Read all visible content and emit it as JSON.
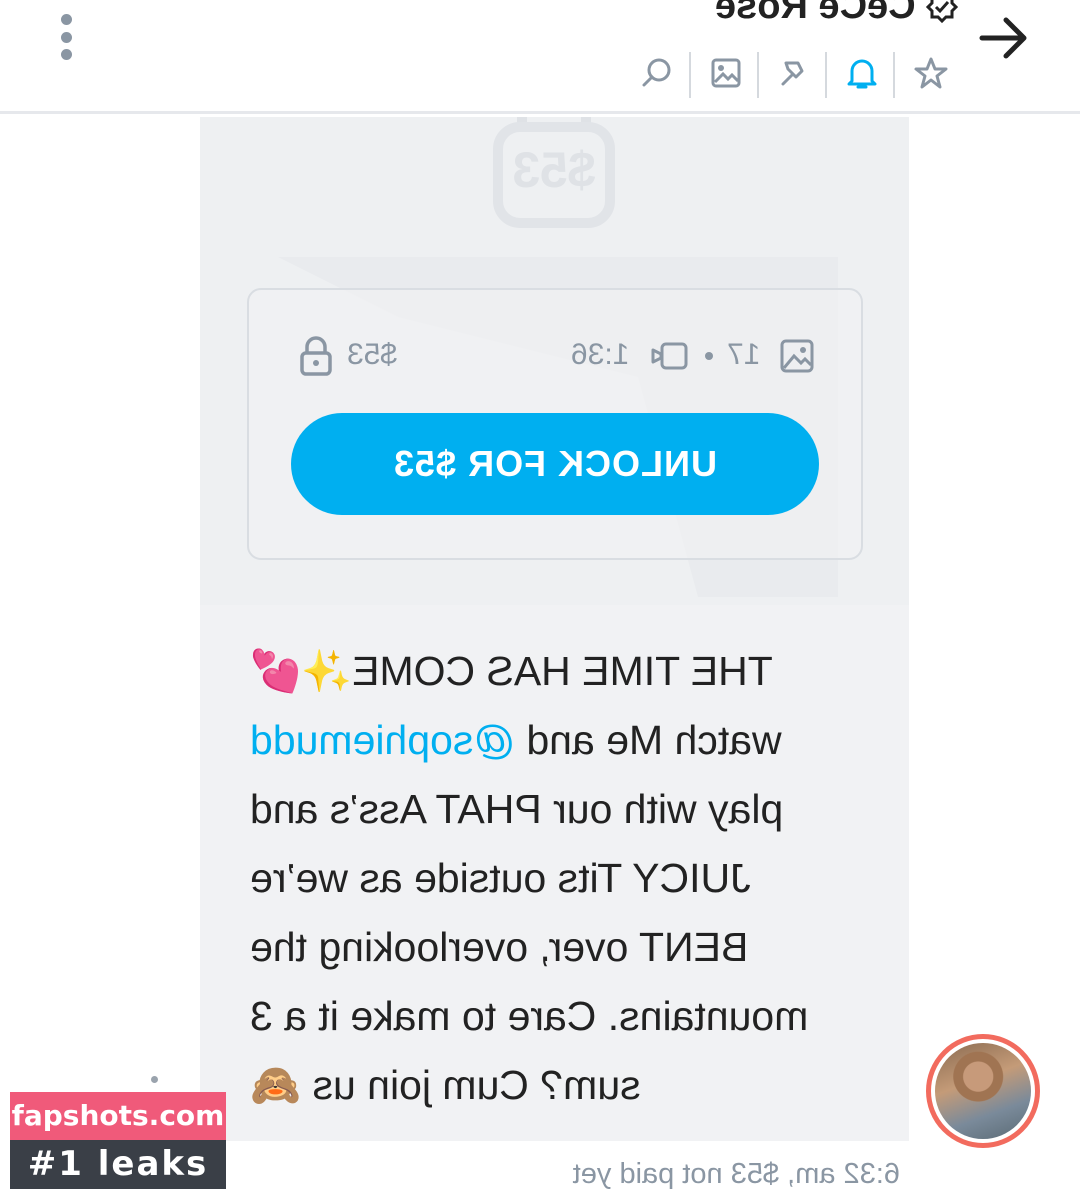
{
  "header": {
    "title": "CeCe Rose",
    "menu_icon": "kebab-menu-icon",
    "back_icon": "arrow-right-icon",
    "toolbar": [
      "search-icon",
      "image-icon",
      "pin-icon",
      "bell-icon",
      "star-icon"
    ],
    "accent_color": "#00aff0"
  },
  "locked_media": {
    "bubble_price": "$53",
    "price": "$53",
    "duration": "1:36",
    "image_count": "17",
    "unlock_label": "UNLOCK FOR $53"
  },
  "message": {
    "lines": [
      {
        "text": "THE TIME HAS COME",
        "emoji": "✨💕"
      },
      {
        "text": "watch Me and ",
        "mention": "@sophiemudd"
      },
      {
        "text": "play with our PHAT Ass’s and"
      },
      {
        "text": "JUICY Tits outside as we’re"
      },
      {
        "text": "BENT over, overlooking the"
      },
      {
        "text": "mountains. Care to make it a 3"
      },
      {
        "text": "sum? Cum join us ",
        "emoji": "🙈"
      }
    ],
    "timestamp": "6:32 am, $53 not paid yet"
  },
  "watermark": {
    "site": "fapshots.com",
    "tagline": "#1 leaks"
  }
}
